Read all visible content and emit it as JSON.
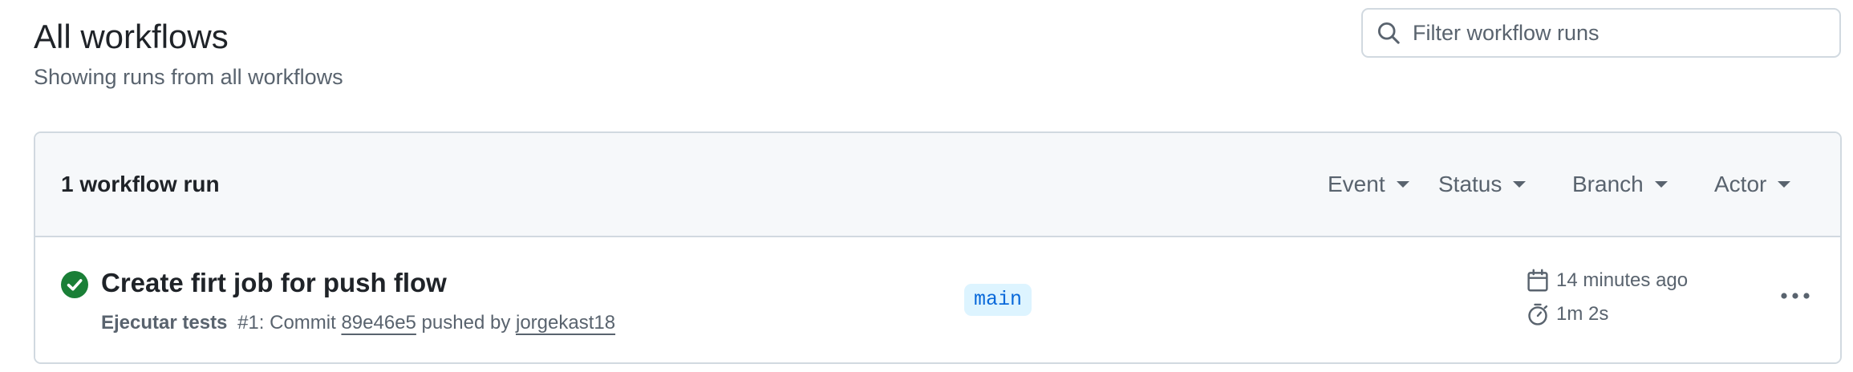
{
  "header": {
    "title": "All workflows",
    "subtitle": "Showing runs from all workflows"
  },
  "search": {
    "placeholder": "Filter workflow runs",
    "value": "",
    "icon": "search-icon"
  },
  "runs": {
    "count_label": "1 workflow run",
    "filters": [
      {
        "label": "Event",
        "icon": "triangle-down-icon"
      },
      {
        "label": "Status",
        "icon": "triangle-down-icon"
      },
      {
        "label": "Branch",
        "icon": "triangle-down-icon"
      },
      {
        "label": "Actor",
        "icon": "triangle-down-icon"
      }
    ],
    "items": [
      {
        "status": "success",
        "status_icon": "check-circle-fill-icon",
        "status_color": "#1a7f37",
        "title": "Create firt job for push flow",
        "workflow_name": "Ejecutar tests",
        "run_number": "#1",
        "commit_prefix": ": Commit ",
        "commit_sha": "89e46e5",
        "pushed_by_text": " pushed by ",
        "actor": "jorgekast18",
        "branch": "main",
        "time_ago": "14 minutes ago",
        "duration": "1m 2s",
        "time_icon": "calendar-icon",
        "duration_icon": "stopwatch-icon",
        "menu_icon": "kebab-horizontal-icon"
      }
    ]
  },
  "colors": {
    "text": "#1f2328",
    "muted": "#59636e",
    "border": "#d1d9e0",
    "header_bg": "#f6f8fa",
    "success": "#1a7f37",
    "branch_bg": "#ddf4ff",
    "branch_fg": "#0969da"
  }
}
